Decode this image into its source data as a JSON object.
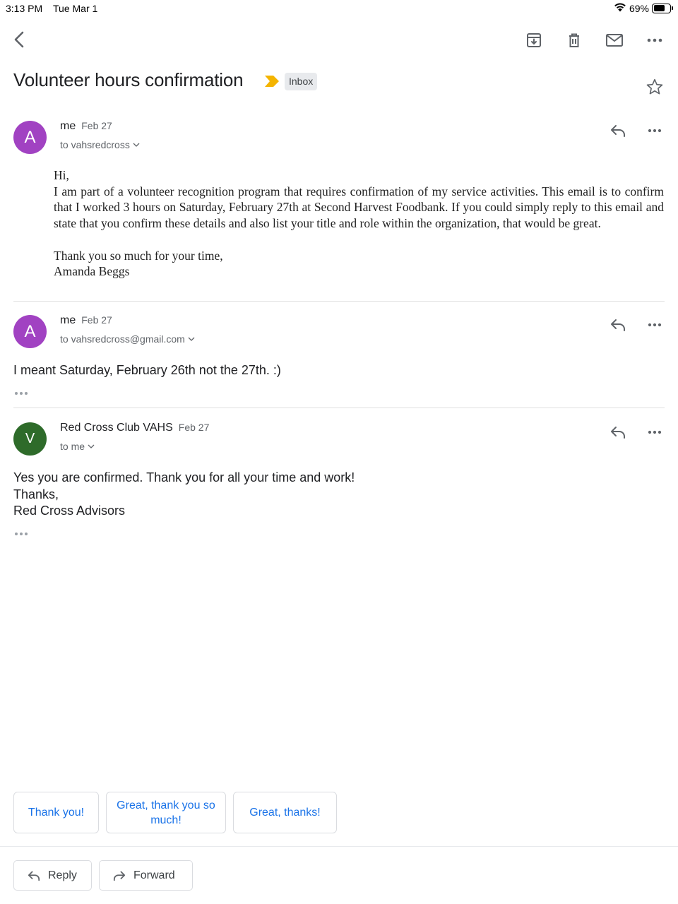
{
  "status_bar": {
    "time": "3:13 PM",
    "date": "Tue Mar 1",
    "battery": "69%",
    "battery_level": 0.69
  },
  "toolbar": {
    "icons": [
      "back-icon",
      "archive-icon",
      "trash-icon",
      "mail-icon",
      "more-icon"
    ]
  },
  "thread": {
    "subject": "Volunteer hours confirmation",
    "label": "Inbox",
    "starred": false
  },
  "messages": [
    {
      "avatar_letter": "A",
      "avatar_color": "#a142c2",
      "sender": "me",
      "date": "Feb 27",
      "recipient": "to vahsredcross",
      "body": {
        "greeting": "Hi,",
        "paragraph": "I am part of a volunteer recognition program that requires confirmation of my service activities. This email is to confirm that I worked 3 hours on Saturday, February 27th at Second Harvest Foodbank. If you could simply reply to this email and state that you confirm these details and also list your title and role within the organization, that would be great.",
        "closing": "Thank you so much for your time,",
        "signature": "Amanda Beggs"
      }
    },
    {
      "avatar_letter": "A",
      "avatar_color": "#a142c2",
      "sender": "me",
      "date": "Feb 27",
      "recipient": "to vahsredcross@gmail.com",
      "body": {
        "text": "I meant Saturday, February 26th not the 27th. :)"
      }
    },
    {
      "avatar_letter": "V",
      "avatar_color": "#2e6b2a",
      "sender": "Red Cross Club VAHS",
      "date": "Feb 27",
      "recipient": "to me",
      "body": {
        "line1": "Yes you are confirmed. Thank you for all your time and work!",
        "line2": "Thanks,",
        "line3": "Red Cross Advisors"
      }
    }
  ],
  "smart_replies": [
    "Thank you!",
    "Great, thank you so much!",
    "Great, thanks!"
  ],
  "actions": {
    "reply": "Reply",
    "forward": "Forward"
  }
}
